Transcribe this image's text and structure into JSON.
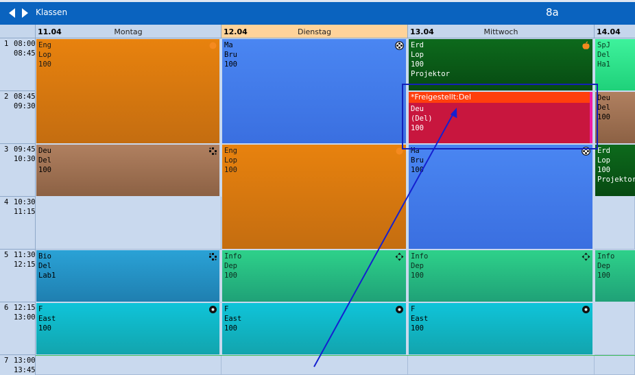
{
  "header": {
    "title": "Klassen",
    "class_name": "8a"
  },
  "days": [
    {
      "date": "11.04",
      "name": "Montag"
    },
    {
      "date": "12.04",
      "name": "Dienstag"
    },
    {
      "date": "13.04",
      "name": "Mittwoch"
    },
    {
      "date": "14.04",
      "name": ""
    }
  ],
  "periods": [
    {
      "num": "1",
      "start": "08:00",
      "end": "08:45"
    },
    {
      "num": "2",
      "start": "08:45",
      "end": "09:30"
    },
    {
      "num": "3",
      "start": "09:45",
      "end": "10:30"
    },
    {
      "num": "4",
      "start": "10:30",
      "end": "11:15"
    },
    {
      "num": "5",
      "start": "11:30",
      "end": "12:15"
    },
    {
      "num": "6",
      "start": "12:15",
      "end": "13:00"
    },
    {
      "num": "7",
      "start": "13:00",
      "end": "13:45"
    }
  ],
  "lessons": {
    "mo_eng": {
      "l1": "Eng",
      "l2": "Lop",
      "l3": "100"
    },
    "mo_deu": {
      "l1": "Deu",
      "l2": "Del",
      "l3": "100"
    },
    "mo_bio": {
      "l1": "Bio",
      "l2": "Del",
      "l3": "Lab1"
    },
    "mo_f": {
      "l1": "F",
      "l2": "East",
      "l3": "100"
    },
    "di_ma": {
      "l1": "Ma",
      "l2": "Bru",
      "l3": "100"
    },
    "di_eng": {
      "l1": "Eng",
      "l2": "Lop",
      "l3": "100"
    },
    "di_info": {
      "l1": "Info",
      "l2": "Dep",
      "l3": "100"
    },
    "di_f": {
      "l1": "F",
      "l2": "East",
      "l3": "100"
    },
    "mi_erd": {
      "l1": "Erd",
      "l2": "Lop",
      "l3": "100",
      "l4": "Projektor"
    },
    "mi_deu": {
      "banner": "*Freigestellt:Del",
      "l1": "Deu",
      "l2": "(Del)",
      "l3": "100"
    },
    "mi_ma": {
      "l1": "Ma",
      "l2": "Bru",
      "l3": "100"
    },
    "mi_info": {
      "l1": "Info",
      "l2": "Dep",
      "l3": "100"
    },
    "mi_f": {
      "l1": "F",
      "l2": "East",
      "l3": "100"
    },
    "do_spj": {
      "l1": "SpJ",
      "l2": "Del",
      "l3": "Ha1"
    },
    "do_deu": {
      "l1": "Deu",
      "l2": "Del",
      "l3": "100"
    },
    "do_erd": {
      "l1": "Erd",
      "l2": "Lop",
      "l3": "100",
      "l4": "Projektor"
    },
    "do_info": {
      "l1": "Info",
      "l2": "Dep",
      "l3": "100"
    }
  },
  "colors": {
    "titlebar": "#0a63bf",
    "today_header": "#ffd39a",
    "selection_frame": "#1420b8",
    "drag_arrow": "#1420d0"
  }
}
